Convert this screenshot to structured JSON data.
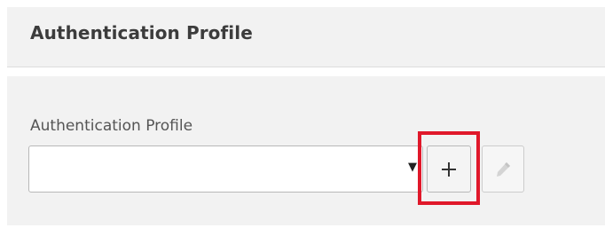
{
  "section": {
    "title": "Authentication Profile"
  },
  "form": {
    "field_label": "Authentication Profile",
    "select": {
      "value": "",
      "arrow_glyph": "▼"
    },
    "add_button": {
      "icon": "plus-icon"
    },
    "edit_button": {
      "icon": "pencil-icon",
      "state": "disabled"
    }
  },
  "annotation": {
    "highlight_color": "#e0182a",
    "target": "add-button"
  }
}
